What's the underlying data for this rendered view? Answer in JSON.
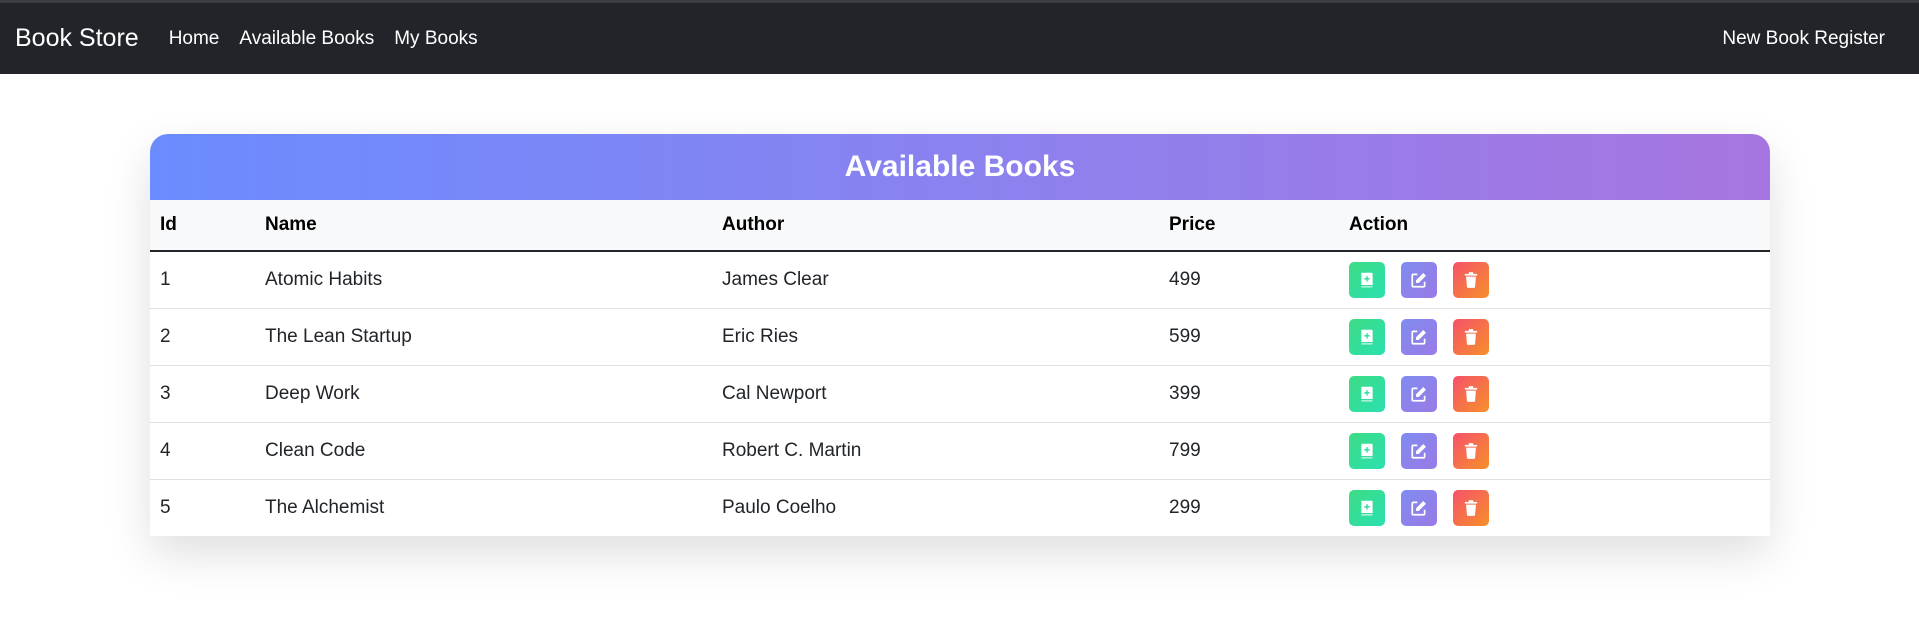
{
  "navbar": {
    "brand": "Book Store",
    "links": [
      "Home",
      "Available Books",
      "My Books"
    ],
    "right_link": "New Book Register",
    "background": "#212529"
  },
  "card": {
    "title": "Available Books",
    "gradient": [
      "#6b8cff",
      "#a775e1"
    ]
  },
  "table": {
    "headers": [
      "Id",
      "Name",
      "Author",
      "Price",
      "Action"
    ],
    "rows": [
      {
        "id": "1",
        "name": "Atomic Habits",
        "author": "James Clear",
        "price": "499"
      },
      {
        "id": "2",
        "name": "The Lean Startup",
        "author": "Eric Ries",
        "price": "599"
      },
      {
        "id": "3",
        "name": "Deep Work",
        "author": "Cal Newport",
        "price": "399"
      },
      {
        "id": "4",
        "name": "Clean Code",
        "author": "Robert C. Martin",
        "price": "799"
      },
      {
        "id": "5",
        "name": "The Alchemist",
        "author": "Paulo Coelho",
        "price": "299"
      }
    ],
    "actions": [
      {
        "name": "add-to-my-books",
        "icon": "book-plus-icon",
        "color": "#3ddc84"
      },
      {
        "name": "edit",
        "icon": "edit-icon",
        "color": "#8a82ef"
      },
      {
        "name": "delete",
        "icon": "trash-icon",
        "color": "#f6516a"
      }
    ]
  }
}
